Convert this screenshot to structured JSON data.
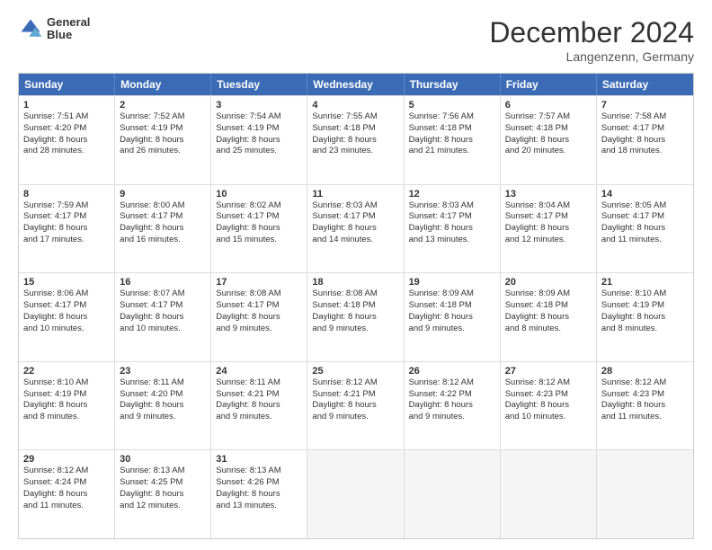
{
  "header": {
    "logo_line1": "General",
    "logo_line2": "Blue",
    "month_title": "December 2024",
    "location": "Langenzenn, Germany"
  },
  "days_of_week": [
    "Sunday",
    "Monday",
    "Tuesday",
    "Wednesday",
    "Thursday",
    "Friday",
    "Saturday"
  ],
  "rows": [
    [
      {
        "day": "1",
        "lines": [
          "Sunrise: 7:51 AM",
          "Sunset: 4:20 PM",
          "Daylight: 8 hours",
          "and 28 minutes."
        ]
      },
      {
        "day": "2",
        "lines": [
          "Sunrise: 7:52 AM",
          "Sunset: 4:19 PM",
          "Daylight: 8 hours",
          "and 26 minutes."
        ]
      },
      {
        "day": "3",
        "lines": [
          "Sunrise: 7:54 AM",
          "Sunset: 4:19 PM",
          "Daylight: 8 hours",
          "and 25 minutes."
        ]
      },
      {
        "day": "4",
        "lines": [
          "Sunrise: 7:55 AM",
          "Sunset: 4:18 PM",
          "Daylight: 8 hours",
          "and 23 minutes."
        ]
      },
      {
        "day": "5",
        "lines": [
          "Sunrise: 7:56 AM",
          "Sunset: 4:18 PM",
          "Daylight: 8 hours",
          "and 21 minutes."
        ]
      },
      {
        "day": "6",
        "lines": [
          "Sunrise: 7:57 AM",
          "Sunset: 4:18 PM",
          "Daylight: 8 hours",
          "and 20 minutes."
        ]
      },
      {
        "day": "7",
        "lines": [
          "Sunrise: 7:58 AM",
          "Sunset: 4:17 PM",
          "Daylight: 8 hours",
          "and 18 minutes."
        ]
      }
    ],
    [
      {
        "day": "8",
        "lines": [
          "Sunrise: 7:59 AM",
          "Sunset: 4:17 PM",
          "Daylight: 8 hours",
          "and 17 minutes."
        ]
      },
      {
        "day": "9",
        "lines": [
          "Sunrise: 8:00 AM",
          "Sunset: 4:17 PM",
          "Daylight: 8 hours",
          "and 16 minutes."
        ]
      },
      {
        "day": "10",
        "lines": [
          "Sunrise: 8:02 AM",
          "Sunset: 4:17 PM",
          "Daylight: 8 hours",
          "and 15 minutes."
        ]
      },
      {
        "day": "11",
        "lines": [
          "Sunrise: 8:03 AM",
          "Sunset: 4:17 PM",
          "Daylight: 8 hours",
          "and 14 minutes."
        ]
      },
      {
        "day": "12",
        "lines": [
          "Sunrise: 8:03 AM",
          "Sunset: 4:17 PM",
          "Daylight: 8 hours",
          "and 13 minutes."
        ]
      },
      {
        "day": "13",
        "lines": [
          "Sunrise: 8:04 AM",
          "Sunset: 4:17 PM",
          "Daylight: 8 hours",
          "and 12 minutes."
        ]
      },
      {
        "day": "14",
        "lines": [
          "Sunrise: 8:05 AM",
          "Sunset: 4:17 PM",
          "Daylight: 8 hours",
          "and 11 minutes."
        ]
      }
    ],
    [
      {
        "day": "15",
        "lines": [
          "Sunrise: 8:06 AM",
          "Sunset: 4:17 PM",
          "Daylight: 8 hours",
          "and 10 minutes."
        ]
      },
      {
        "day": "16",
        "lines": [
          "Sunrise: 8:07 AM",
          "Sunset: 4:17 PM",
          "Daylight: 8 hours",
          "and 10 minutes."
        ]
      },
      {
        "day": "17",
        "lines": [
          "Sunrise: 8:08 AM",
          "Sunset: 4:17 PM",
          "Daylight: 8 hours",
          "and 9 minutes."
        ]
      },
      {
        "day": "18",
        "lines": [
          "Sunrise: 8:08 AM",
          "Sunset: 4:18 PM",
          "Daylight: 8 hours",
          "and 9 minutes."
        ]
      },
      {
        "day": "19",
        "lines": [
          "Sunrise: 8:09 AM",
          "Sunset: 4:18 PM",
          "Daylight: 8 hours",
          "and 9 minutes."
        ]
      },
      {
        "day": "20",
        "lines": [
          "Sunrise: 8:09 AM",
          "Sunset: 4:18 PM",
          "Daylight: 8 hours",
          "and 8 minutes."
        ]
      },
      {
        "day": "21",
        "lines": [
          "Sunrise: 8:10 AM",
          "Sunset: 4:19 PM",
          "Daylight: 8 hours",
          "and 8 minutes."
        ]
      }
    ],
    [
      {
        "day": "22",
        "lines": [
          "Sunrise: 8:10 AM",
          "Sunset: 4:19 PM",
          "Daylight: 8 hours",
          "and 8 minutes."
        ]
      },
      {
        "day": "23",
        "lines": [
          "Sunrise: 8:11 AM",
          "Sunset: 4:20 PM",
          "Daylight: 8 hours",
          "and 9 minutes."
        ]
      },
      {
        "day": "24",
        "lines": [
          "Sunrise: 8:11 AM",
          "Sunset: 4:21 PM",
          "Daylight: 8 hours",
          "and 9 minutes."
        ]
      },
      {
        "day": "25",
        "lines": [
          "Sunrise: 8:12 AM",
          "Sunset: 4:21 PM",
          "Daylight: 8 hours",
          "and 9 minutes."
        ]
      },
      {
        "day": "26",
        "lines": [
          "Sunrise: 8:12 AM",
          "Sunset: 4:22 PM",
          "Daylight: 8 hours",
          "and 9 minutes."
        ]
      },
      {
        "day": "27",
        "lines": [
          "Sunrise: 8:12 AM",
          "Sunset: 4:23 PM",
          "Daylight: 8 hours",
          "and 10 minutes."
        ]
      },
      {
        "day": "28",
        "lines": [
          "Sunrise: 8:12 AM",
          "Sunset: 4:23 PM",
          "Daylight: 8 hours",
          "and 11 minutes."
        ]
      }
    ],
    [
      {
        "day": "29",
        "lines": [
          "Sunrise: 8:12 AM",
          "Sunset: 4:24 PM",
          "Daylight: 8 hours",
          "and 11 minutes."
        ]
      },
      {
        "day": "30",
        "lines": [
          "Sunrise: 8:13 AM",
          "Sunset: 4:25 PM",
          "Daylight: 8 hours",
          "and 12 minutes."
        ]
      },
      {
        "day": "31",
        "lines": [
          "Sunrise: 8:13 AM",
          "Sunset: 4:26 PM",
          "Daylight: 8 hours",
          "and 13 minutes."
        ]
      },
      null,
      null,
      null,
      null
    ]
  ]
}
